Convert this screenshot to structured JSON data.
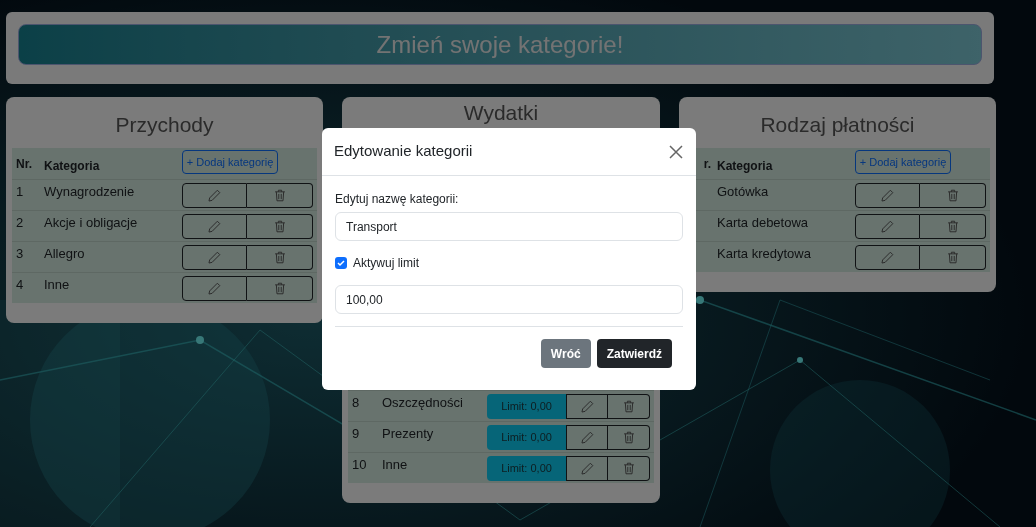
{
  "header": {
    "title": "Zmień swoje kategorie!"
  },
  "cards": [
    {
      "title": "Przychody",
      "columns": {
        "nr": "Nr.",
        "name": "Kategoria"
      },
      "add_button": "+ Dodaj kategorię",
      "rows": [
        {
          "nr": "1",
          "name": "Wynagrodzenie"
        },
        {
          "nr": "2",
          "name": "Akcje i obligacje"
        },
        {
          "nr": "3",
          "name": "Allegro"
        },
        {
          "nr": "4",
          "name": "Inne"
        }
      ]
    },
    {
      "title": "Wydatki",
      "rows": [
        {
          "nr": "8",
          "name": "Oszczędności",
          "limit": "Limit: 0,00"
        },
        {
          "nr": "9",
          "name": "Prezenty",
          "limit": "Limit: 0,00"
        },
        {
          "nr": "10",
          "name": "Inne",
          "limit": "Limit: 0,00"
        }
      ]
    },
    {
      "title": "Rodzaj płatności",
      "columns": {
        "nr": "r.",
        "name": "Kategoria"
      },
      "add_button": "+ Dodaj kategorię",
      "rows": [
        {
          "name": "Gotówka"
        },
        {
          "name": "Karta debetowa"
        },
        {
          "name": "Karta kredytowa"
        }
      ]
    }
  ],
  "modal": {
    "title": "Edytowanie kategorii",
    "name_label": "Edytuj nazwę kategorii:",
    "name_value": "Transport",
    "limit_checkbox": {
      "label": "Aktywuj limit",
      "checked": true
    },
    "limit_value": "100,00",
    "buttons": [
      {
        "label": "Wróć",
        "kind": "secondary"
      },
      {
        "label": "Zatwierdź",
        "kind": "primary"
      }
    ]
  }
}
